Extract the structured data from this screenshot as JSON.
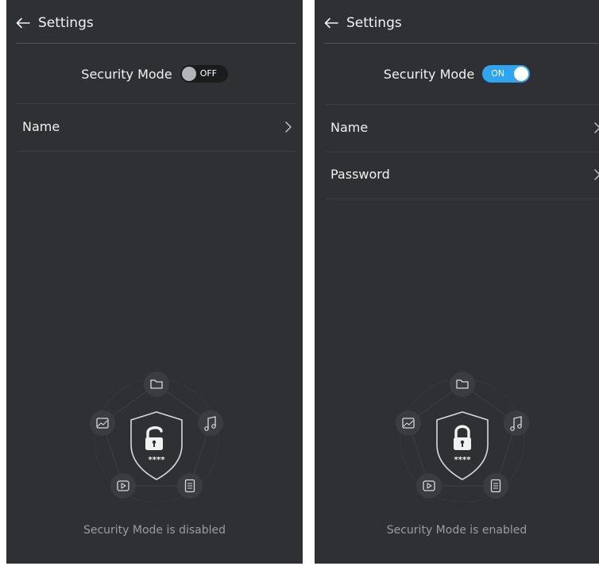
{
  "screens": [
    {
      "title": "Settings",
      "security": {
        "label": "Security Mode",
        "state": "OFF"
      },
      "items": [
        {
          "label": "Name"
        }
      ],
      "status": "Security Mode is disabled",
      "lock_code": "****"
    },
    {
      "title": "Settings",
      "security": {
        "label": "Security Mode",
        "state": "ON"
      },
      "items": [
        {
          "label": "Name"
        },
        {
          "label": "Password"
        }
      ],
      "status": "Security Mode is enabled",
      "lock_code": "****"
    }
  ],
  "colors": {
    "background": "#2f3033",
    "toggle_on": "#2fa4f0",
    "toggle_off": "#1a1b1d",
    "text_primary": "#f1f1f1",
    "text_secondary": "#9a9ca0"
  },
  "icons": [
    "back-arrow-icon",
    "chevron-right-icon",
    "folder-icon",
    "music-icon",
    "document-icon",
    "video-icon",
    "image-icon",
    "shield-icon",
    "unlocked-padlock-icon",
    "locked-padlock-icon"
  ]
}
